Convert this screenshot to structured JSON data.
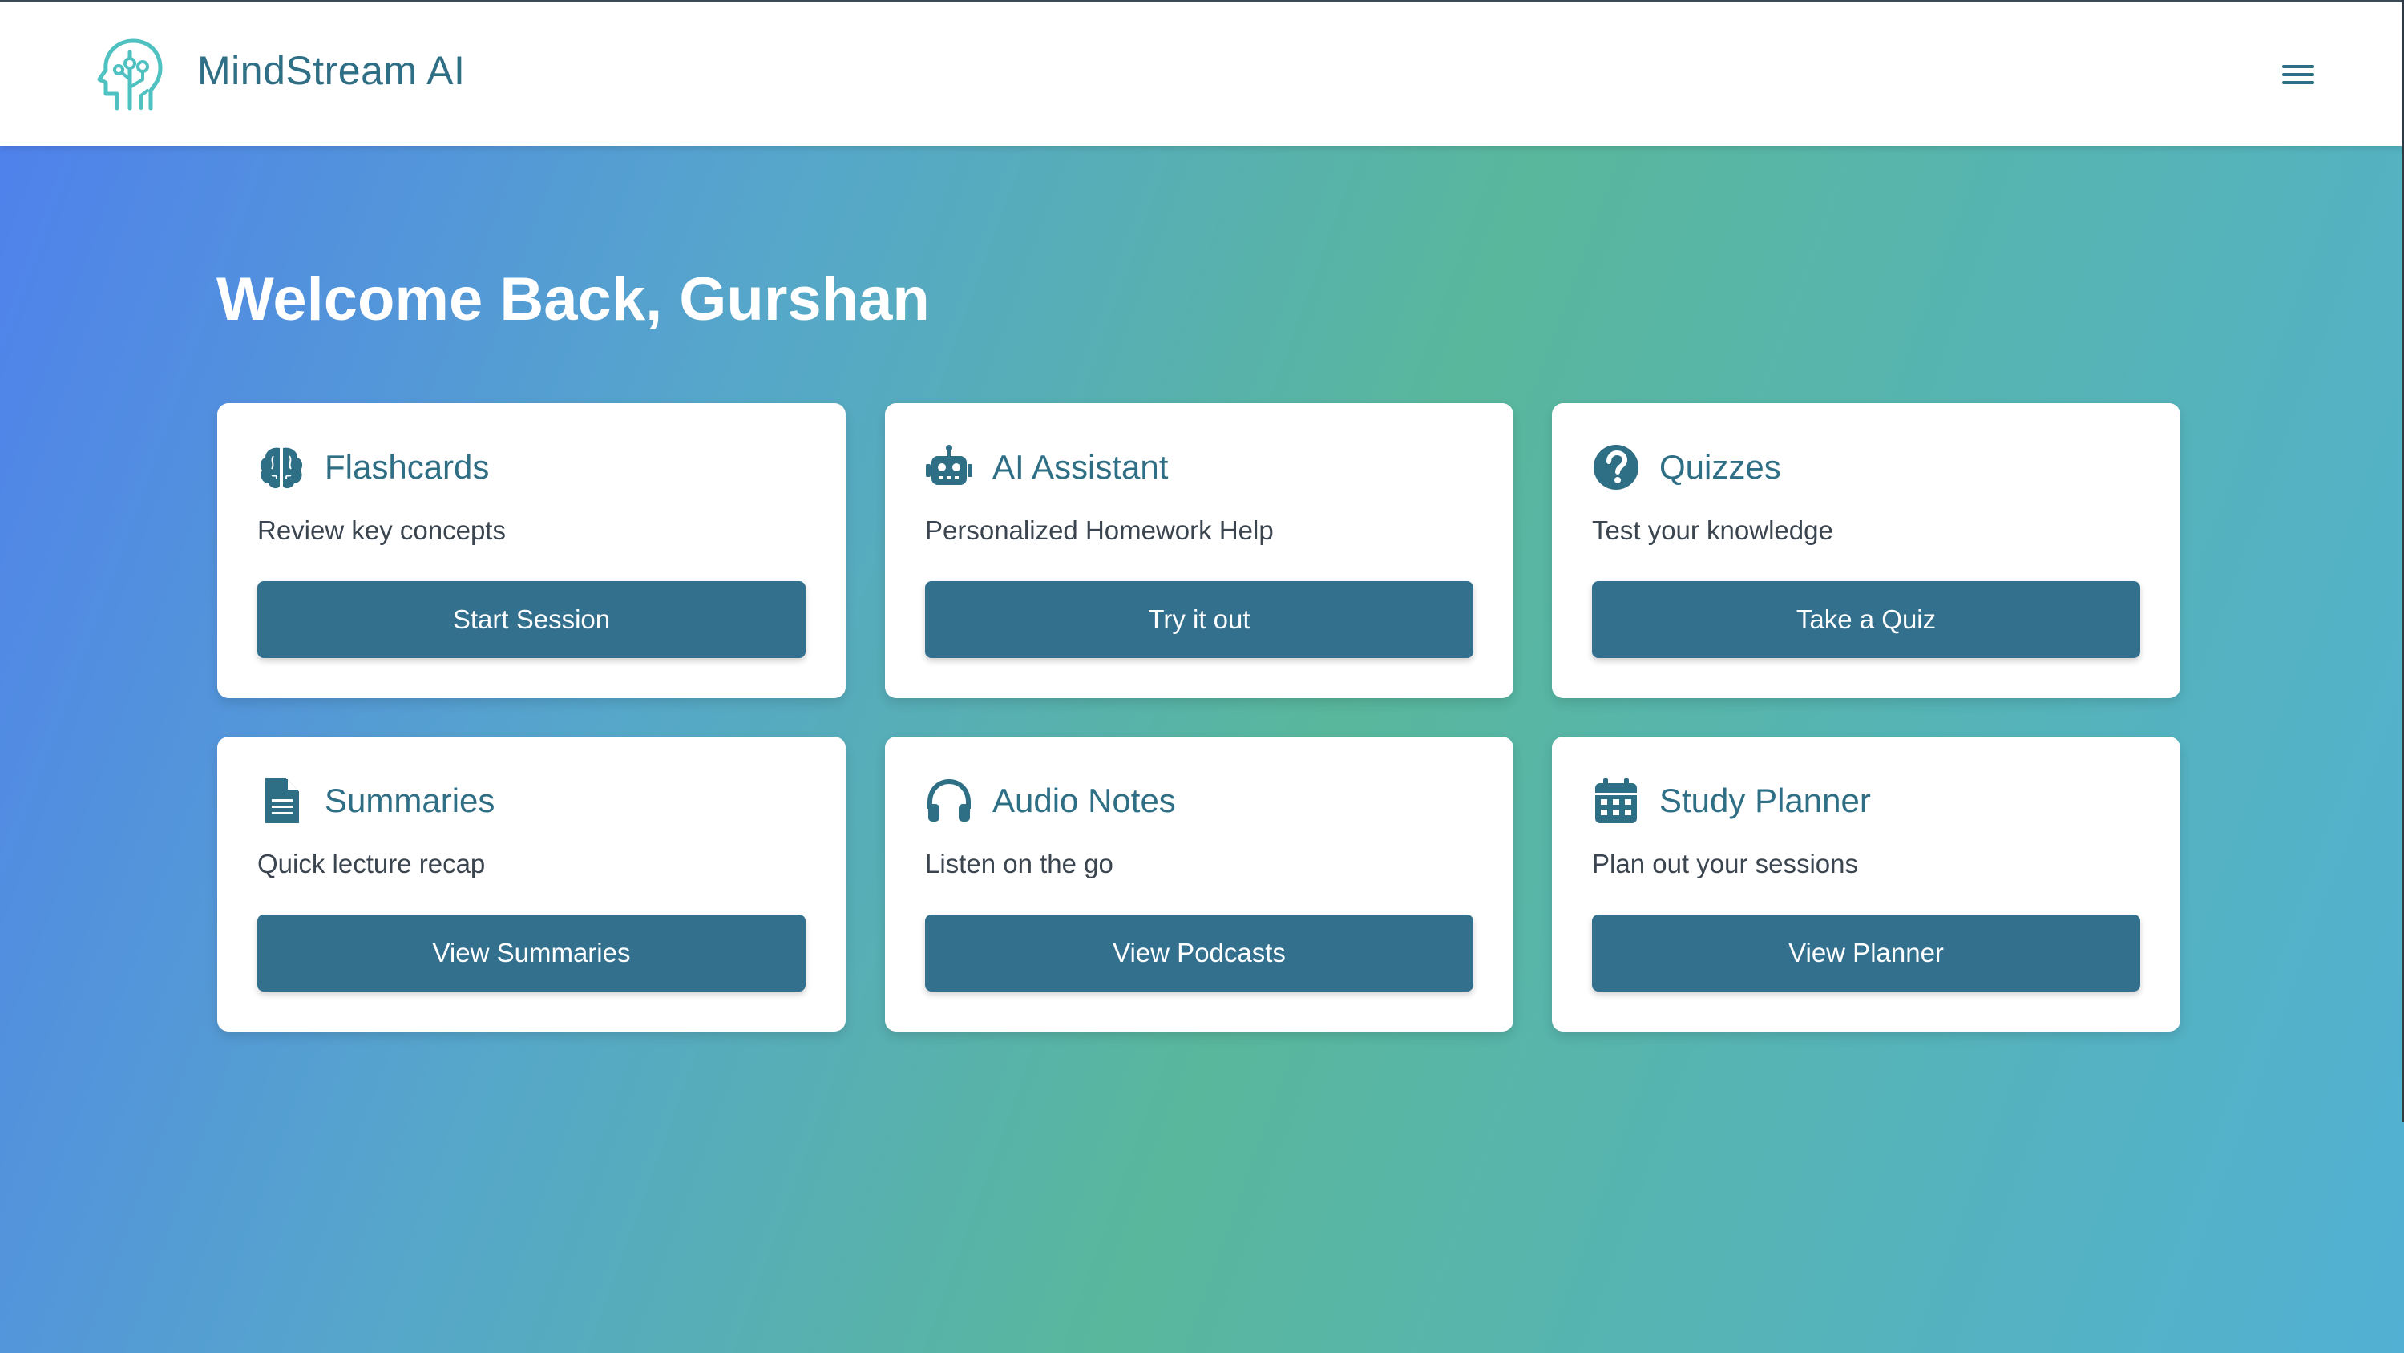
{
  "header": {
    "brand_name": "MindStream AI",
    "logo_icon": "brain-head-icon",
    "menu_icon": "hamburger-menu-icon"
  },
  "main": {
    "welcome_text": "Welcome Back, Gurshan"
  },
  "cards": [
    {
      "title": "Flashcards",
      "description": "Review key concepts",
      "button_label": "Start Session",
      "icon": "brain-icon"
    },
    {
      "title": "AI Assistant",
      "description": "Personalized Homework Help",
      "button_label": "Try it out",
      "icon": "robot-icon"
    },
    {
      "title": "Quizzes",
      "description": "Test your knowledge",
      "button_label": "Take a Quiz",
      "icon": "question-circle-icon"
    },
    {
      "title": "Summaries",
      "description": "Quick lecture recap",
      "button_label": "View Summaries",
      "icon": "document-icon"
    },
    {
      "title": "Audio Notes",
      "description": "Listen on the go",
      "button_label": "View Podcasts",
      "icon": "headphones-icon"
    },
    {
      "title": "Study Planner",
      "description": "Plan out your sessions",
      "button_label": "View Planner",
      "icon": "calendar-icon"
    }
  ],
  "colors": {
    "accent": "#2f6f86",
    "button": "#33708e",
    "logo": "#4fc1c0",
    "gradient_start": "#4f7fee",
    "gradient_mid": "#59b79c",
    "gradient_end": "#52b0d4"
  }
}
